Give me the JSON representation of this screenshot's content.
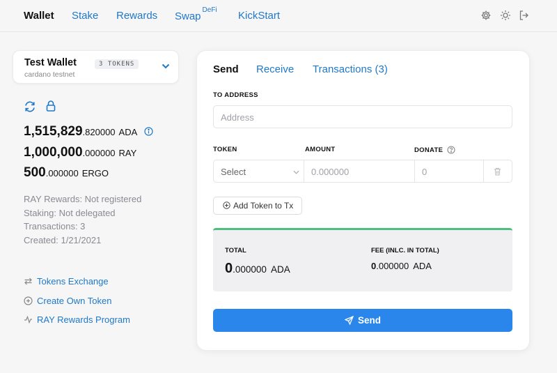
{
  "nav": {
    "wallet": "Wallet",
    "stake": "Stake",
    "rewards": "Rewards",
    "swap": "Swap",
    "swap_badge": "DeFi",
    "kickstart": "KickStart"
  },
  "wallet_card": {
    "name": "Test Wallet",
    "tokens_badge": "3 TOKENS",
    "network": "cardano testnet"
  },
  "balances": [
    {
      "int": "1,515,829",
      "dec": ".820000",
      "cur": "ADA"
    },
    {
      "int": "1,000,000",
      "dec": ".000000",
      "cur": "RAY"
    },
    {
      "int": "500",
      "dec": ".000000",
      "cur": "ERGO"
    }
  ],
  "meta": {
    "ray_rewards": "RAY Rewards: Not registered",
    "staking": "Staking: Not delegated",
    "transactions": "Transactions: 3",
    "created": "Created: 1/21/2021"
  },
  "side_links": {
    "tokens_exchange": "Tokens Exchange",
    "create_token": "Create Own Token",
    "ray_program": "RAY Rewards Program"
  },
  "panel": {
    "tabs": {
      "send": "Send",
      "receive": "Receive",
      "transactions": "Transactions (3)"
    },
    "to_address_label": "TO ADDRESS",
    "address_placeholder": "Address",
    "token_label": "TOKEN",
    "amount_label": "AMOUNT",
    "donate_label": "DONATE",
    "token_select": "Select",
    "amount_placeholder": "0.000000",
    "donate_placeholder": "0",
    "add_token": "Add Token to Tx",
    "total_label": "TOTAL",
    "total_int": "0",
    "total_dec": ".000000",
    "total_cur": "ADA",
    "fee_label": "FEE (INLC. IN TOTAL)",
    "fee_int": "0",
    "fee_dec": ".000000",
    "fee_cur": "ADA",
    "send_button": "Send"
  },
  "colors": {
    "accent": "#1f78c8",
    "send_button": "#2a86ea",
    "summary_border": "#4cbf7f",
    "background": "#f6f6f7"
  },
  "icons": [
    "settings-icon",
    "sun-icon",
    "logout-icon",
    "chevron-down-icon",
    "refresh-icon",
    "lock-icon",
    "info-icon",
    "exchange-icon",
    "plus-circle-icon",
    "activity-icon",
    "help-icon",
    "trash-icon",
    "send-icon"
  ]
}
